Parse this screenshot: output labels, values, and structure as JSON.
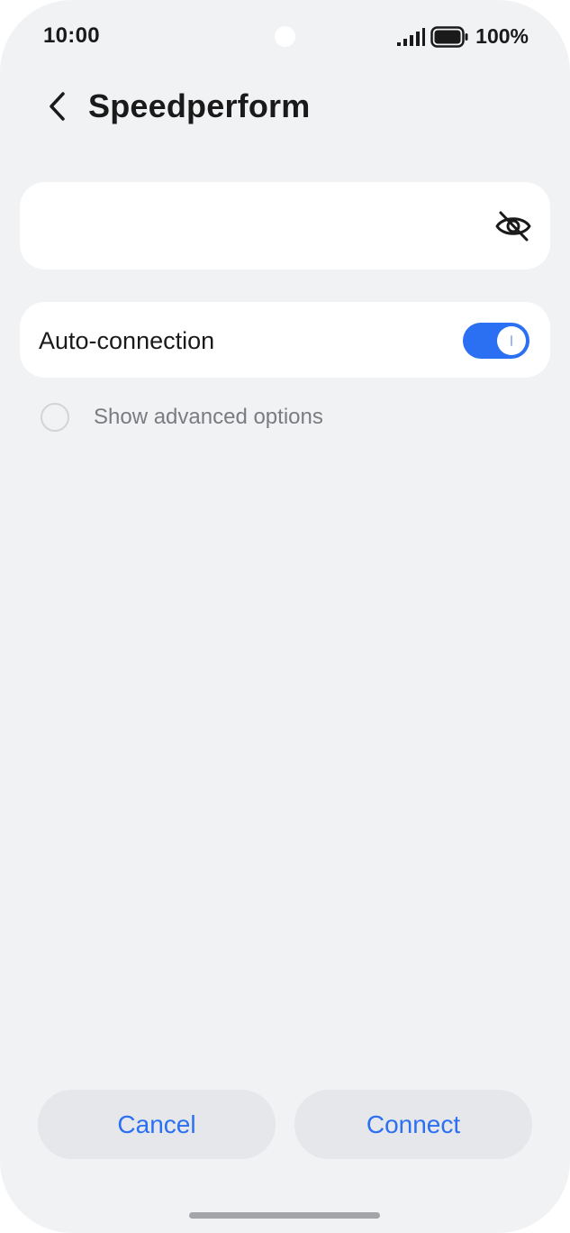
{
  "status_bar": {
    "time": "10:00",
    "battery": "100%",
    "icons": [
      "signal-icon",
      "battery-icon"
    ]
  },
  "header": {
    "title": "Speedperform",
    "back_icon": "chevron-left-icon"
  },
  "password": {
    "value": "",
    "visibility_icon": "eye-off-icon"
  },
  "auto_connection": {
    "label": "Auto-connection",
    "enabled": true
  },
  "advanced": {
    "label": "Show advanced options",
    "checked": false
  },
  "buttons": {
    "cancel": "Cancel",
    "connect": "Connect"
  },
  "colors": {
    "accent": "#2b6ff2",
    "background": "#f1f2f4",
    "card": "#ffffff"
  }
}
